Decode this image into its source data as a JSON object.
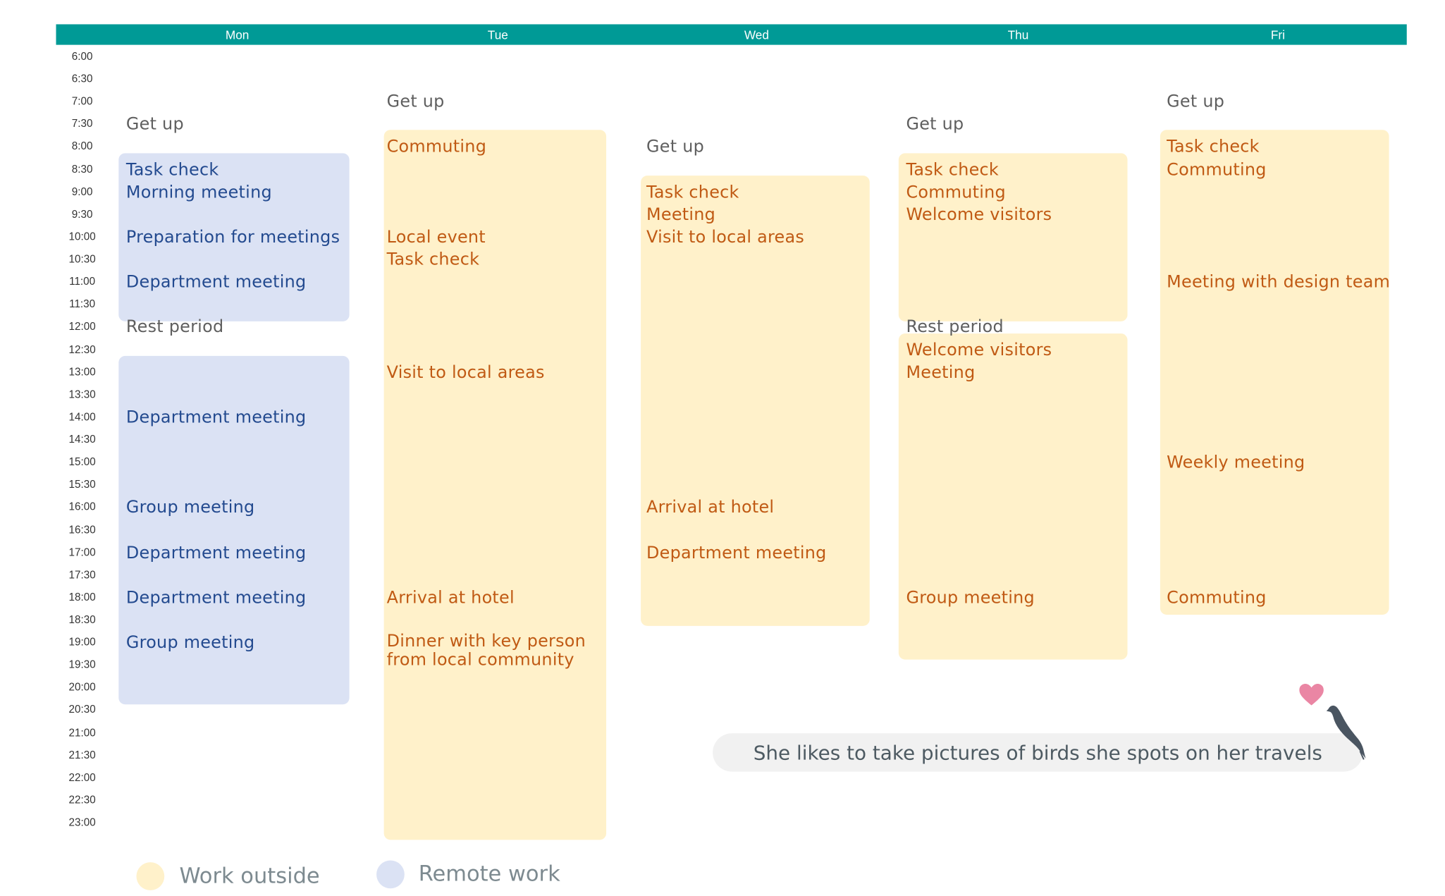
{
  "days": [
    "Mon",
    "Tue",
    "Wed",
    "Thu",
    "Fri"
  ],
  "times": [
    "6:00",
    "6:30",
    "7:00",
    "7:30",
    "8:00",
    "8:30",
    "9:00",
    "9:30",
    "10:00",
    "10:30",
    "11:00",
    "11:30",
    "12:00",
    "12:30",
    "13:00",
    "13:30",
    "14:00",
    "14:30",
    "15:00",
    "15:30",
    "16:00",
    "16:30",
    "17:00",
    "17:30",
    "18:00",
    "18:30",
    "19:00",
    "19:30",
    "20:00",
    "20:30",
    "21:00",
    "21:30",
    "22:00",
    "22:30",
    "23:00"
  ],
  "colors": {
    "header": "#009a96",
    "work_outside_bg": "#fff1ca",
    "remote_work_bg": "#dbe2f4",
    "outside_text": "#c05a14",
    "remote_text": "#234a8f",
    "neutral_text": "#5f5f5f",
    "heart": "#ea86a4",
    "bird": "#4a5561"
  },
  "columns": [
    {
      "day": "Mon",
      "events": [
        {
          "time": "7:30",
          "label": "Get up",
          "type": "plain"
        },
        {
          "time": "8:30",
          "label": "Task check",
          "type": "remote"
        },
        {
          "time": "9:00",
          "label": "Morning meeting",
          "type": "remote"
        },
        {
          "time": "10:00",
          "label": "Preparation for meetings",
          "type": "remote"
        },
        {
          "time": "11:00",
          "label": "Department meeting",
          "type": "remote"
        },
        {
          "time": "12:00",
          "label": "Rest period",
          "type": "plain"
        },
        {
          "time": "14:00",
          "label": "Department meeting",
          "type": "remote"
        },
        {
          "time": "16:00",
          "label": "Group meeting",
          "type": "remote"
        },
        {
          "time": "17:00",
          "label": "Department meeting",
          "type": "remote"
        },
        {
          "time": "18:00",
          "label": "Department meeting",
          "type": "remote"
        },
        {
          "time": "19:00",
          "label": "Group meeting",
          "type": "remote"
        }
      ]
    },
    {
      "day": "Tue",
      "events": [
        {
          "time": "7:00",
          "label": "Get up",
          "type": "plain"
        },
        {
          "time": "8:00",
          "label": "Commuting",
          "type": "outside"
        },
        {
          "time": "10:00",
          "label": "Local event",
          "type": "outside"
        },
        {
          "time": "10:30",
          "label": "Task check",
          "type": "outside"
        },
        {
          "time": "13:00",
          "label": "Visit to local areas",
          "type": "outside"
        },
        {
          "time": "18:00",
          "label": "Arrival at hotel",
          "type": "outside"
        },
        {
          "time": "19:00",
          "label": "Dinner with key person from local community",
          "type": "outside"
        }
      ]
    },
    {
      "day": "Wed",
      "events": [
        {
          "time": "8:00",
          "label": "Get up",
          "type": "plain"
        },
        {
          "time": "9:00",
          "label": "Task check",
          "type": "outside"
        },
        {
          "time": "9:30",
          "label": "Meeting",
          "type": "outside"
        },
        {
          "time": "10:00",
          "label": "Visit to local areas",
          "type": "outside"
        },
        {
          "time": "16:00",
          "label": "Arrival at hotel",
          "type": "outside"
        },
        {
          "time": "17:00",
          "label": "Department meeting",
          "type": "outside"
        }
      ]
    },
    {
      "day": "Thu",
      "events": [
        {
          "time": "7:30",
          "label": "Get up",
          "type": "plain"
        },
        {
          "time": "8:30",
          "label": "Task check",
          "type": "outside"
        },
        {
          "time": "9:00",
          "label": "Commuting",
          "type": "outside"
        },
        {
          "time": "9:30",
          "label": "Welcome visitors",
          "type": "outside"
        },
        {
          "time": "12:00",
          "label": "Rest period",
          "type": "plain"
        },
        {
          "time": "12:30",
          "label": "Welcome visitors",
          "type": "outside"
        },
        {
          "time": "13:00",
          "label": "Meeting",
          "type": "outside"
        },
        {
          "time": "18:00",
          "label": "Group meeting",
          "type": "outside"
        }
      ]
    },
    {
      "day": "Fri",
      "events": [
        {
          "time": "7:00",
          "label": "Get up",
          "type": "plain"
        },
        {
          "time": "8:00",
          "label": "Task check",
          "type": "outside"
        },
        {
          "time": "8:30",
          "label": "Commuting",
          "type": "outside"
        },
        {
          "time": "11:00",
          "label": "Meeting with design team",
          "type": "outside"
        },
        {
          "time": "15:00",
          "label": "Weekly meeting",
          "type": "outside"
        },
        {
          "time": "18:00",
          "label": "Commuting",
          "type": "outside"
        }
      ]
    }
  ],
  "blocks": [
    {
      "day": "Mon",
      "type": "remote",
      "start": "8:15",
      "end": "11:45"
    },
    {
      "day": "Mon",
      "type": "remote",
      "start": "12:45",
      "end": "20:15"
    },
    {
      "day": "Tue",
      "type": "outside",
      "start": "7:45",
      "end": "23:15"
    },
    {
      "day": "Wed",
      "type": "outside",
      "start": "8:45",
      "end": "18:30"
    },
    {
      "day": "Thu",
      "type": "outside",
      "start": "8:15",
      "end": "11:45"
    },
    {
      "day": "Thu",
      "type": "outside",
      "start": "12:15",
      "end": "19:15"
    },
    {
      "day": "Fri",
      "type": "outside",
      "start": "7:45",
      "end": "18:15"
    }
  ],
  "legend": [
    {
      "label": "Work outside",
      "type": "outside"
    },
    {
      "label": "Remote work",
      "type": "remote"
    }
  ],
  "note": {
    "text": "She likes to take pictures of birds she spots on her travels",
    "icons": [
      "heart-icon",
      "bird-icon"
    ]
  }
}
